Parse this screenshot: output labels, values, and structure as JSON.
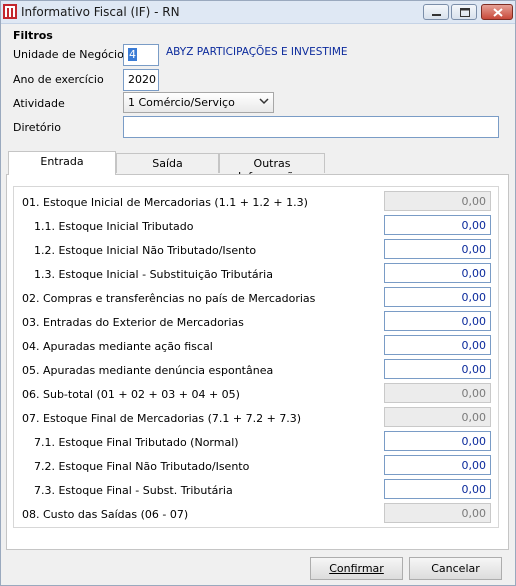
{
  "window": {
    "title": "Informativo Fiscal (IF) - RN",
    "icon": "app-logo-icon"
  },
  "filters": {
    "section_label": "Filtros",
    "unidade_label": "Unidade de Negócio",
    "unidade_value": "4",
    "unidade_name": "ABYZ PARTICIPAÇÕES E INVESTIME",
    "ano_label": "Ano de exercício",
    "ano_value": "2020",
    "atividade_label": "Atividade",
    "atividade_value": "1 Comércio/Serviço",
    "diretorio_label": "Diretório",
    "diretorio_value": ""
  },
  "tabs": [
    {
      "label": "Entrada",
      "active": true
    },
    {
      "label": "Saída",
      "active": false
    },
    {
      "label": "Outras Informações",
      "active": false
    }
  ],
  "rows": [
    {
      "label": "01. Estoque Inicial de Mercadorias (1.1 + 1.2 + 1.3)",
      "value": "0,00",
      "editable": false
    },
    {
      "label": "1.1. Estoque Inicial Tributado",
      "value": "0,00",
      "editable": true
    },
    {
      "label": "1.2. Estoque Inicial Não Tributado/Isento",
      "value": "0,00",
      "editable": true
    },
    {
      "label": "1.3. Estoque Inicial - Substituição Tributária",
      "value": "0,00",
      "editable": true
    },
    {
      "label": "02. Compras e transferências no país de Mercadorias",
      "value": "0,00",
      "editable": true
    },
    {
      "label": "03. Entradas do Exterior de Mercadorias",
      "value": "0,00",
      "editable": true
    },
    {
      "label": "04. Apuradas mediante ação fiscal",
      "value": "0,00",
      "editable": true
    },
    {
      "label": "05. Apuradas mediante denúncia espontânea",
      "value": "0,00",
      "editable": true
    },
    {
      "label": "06. Sub-total (01 + 02 + 03 + 04 + 05)",
      "value": "0,00",
      "editable": false
    },
    {
      "label": "07. Estoque Final de Mercadorias (7.1 + 7.2 + 7.3)",
      "value": "0,00",
      "editable": false
    },
    {
      "label": "7.1. Estoque Final Tributado (Normal)",
      "value": "0,00",
      "editable": true
    },
    {
      "label": "7.2. Estoque Final Não Tributado/Isento",
      "value": "0,00",
      "editable": true
    },
    {
      "label": "7.3. Estoque Final - Subst. Tributária",
      "value": "0,00",
      "editable": true
    },
    {
      "label": "08. Custo das Saídas (06 - 07)",
      "value": "0,00",
      "editable": false
    }
  ],
  "buttons": {
    "confirm_label": "Confirmar",
    "cancel_label": "Cancelar"
  }
}
